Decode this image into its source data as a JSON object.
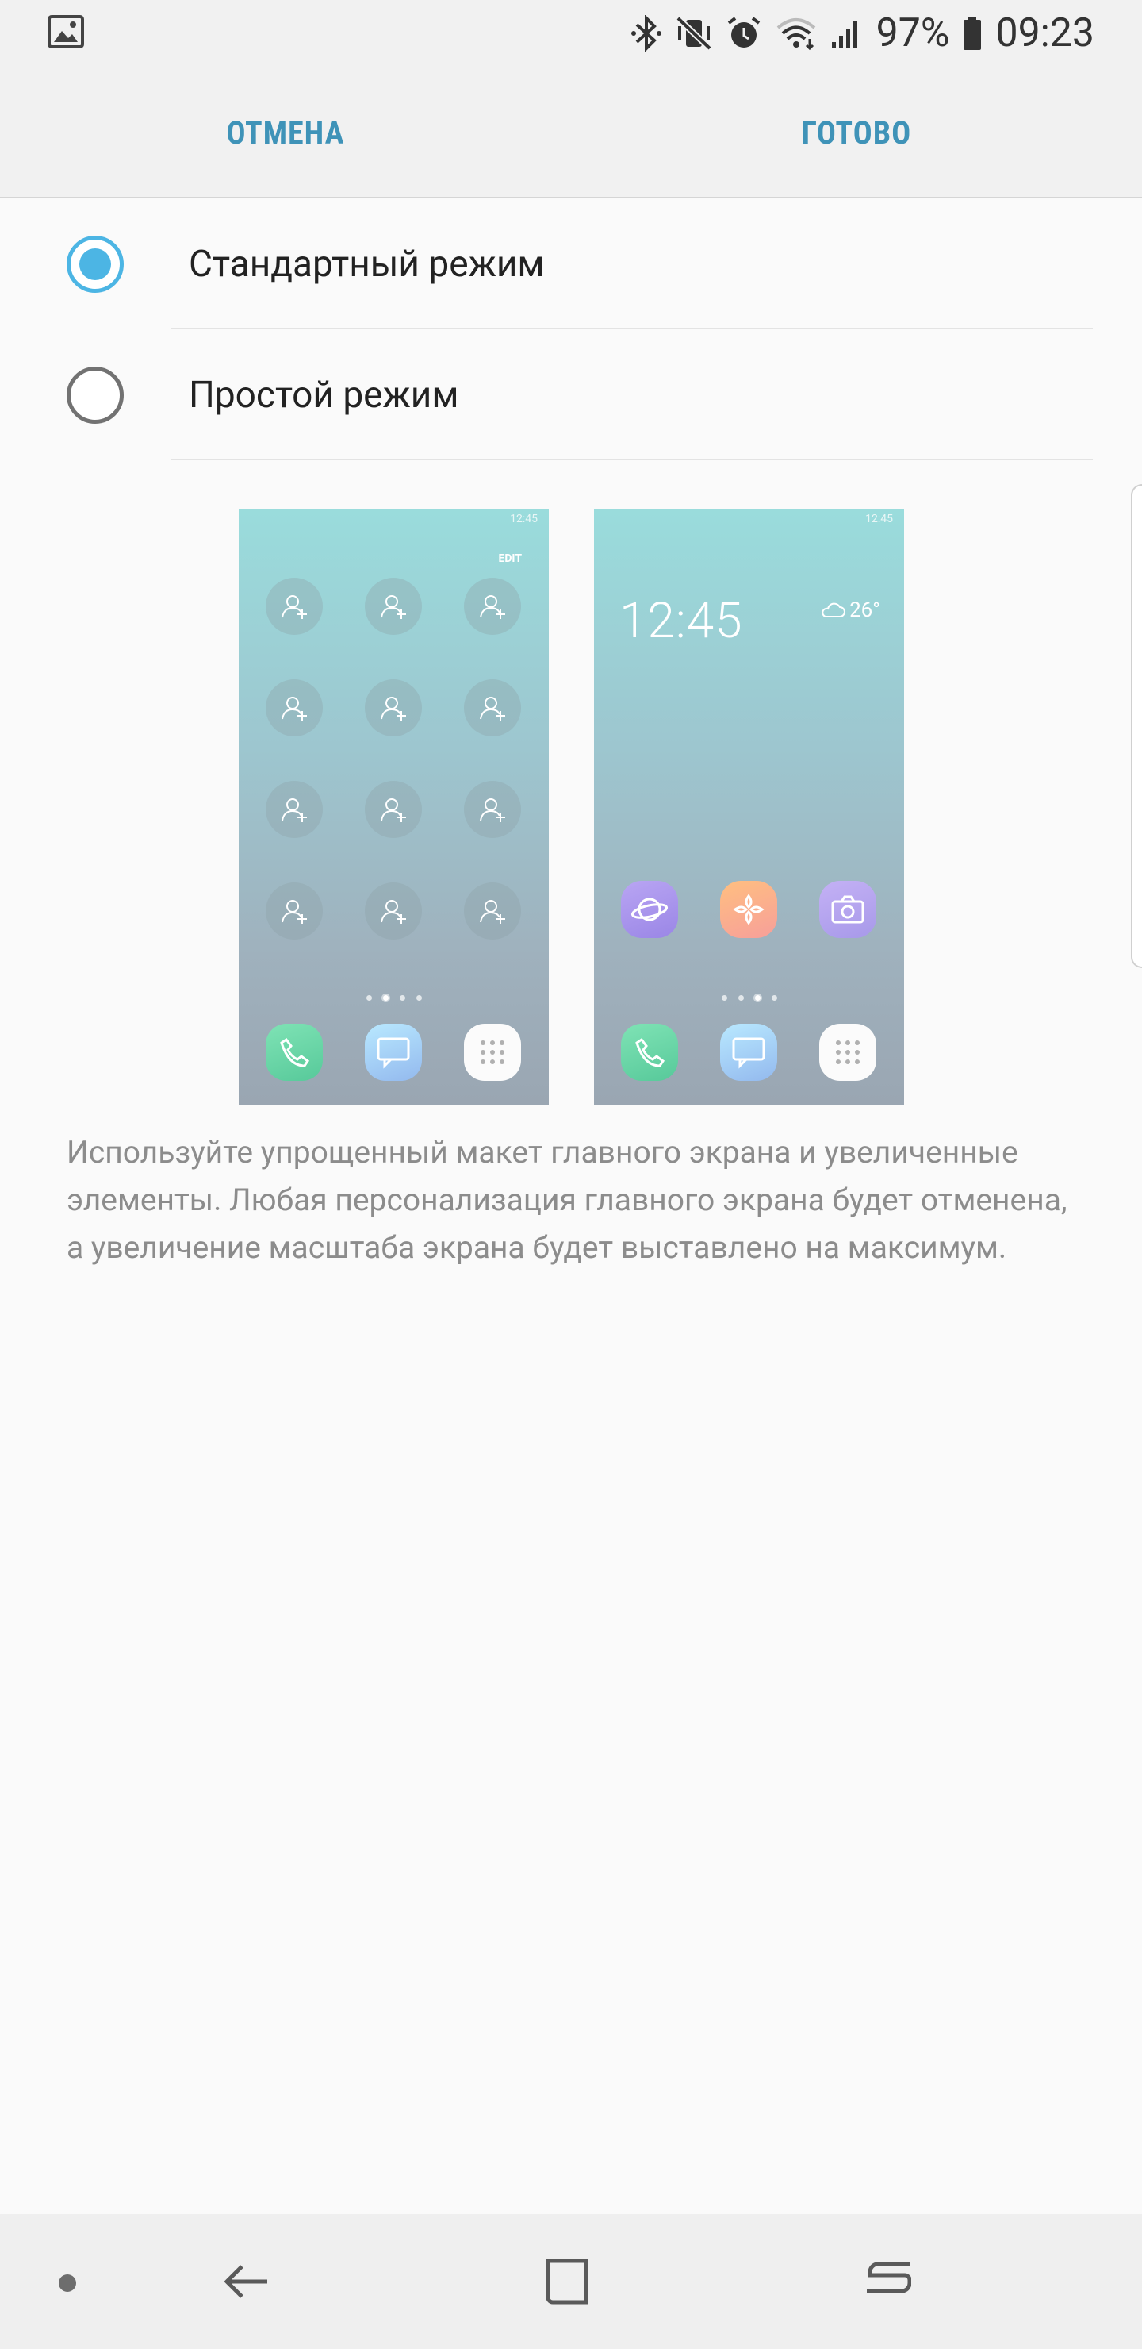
{
  "status_bar": {
    "battery_percent": "97%",
    "time": "09:23",
    "icons": [
      "image-notification-icon",
      "bluetooth-icon",
      "vibrate-mute-icon",
      "alarm-icon",
      "wifi-icon",
      "signal-icon",
      "battery-icon"
    ]
  },
  "action_bar": {
    "cancel_label": "ОТМЕНА",
    "done_label": "ГОТОВО"
  },
  "options": [
    {
      "label": "Стандартный режим",
      "selected": true
    },
    {
      "label": "Простой режим",
      "selected": false
    }
  ],
  "previews": {
    "standard": {
      "status_time": "12:45",
      "edit_label": "EDIT"
    },
    "easy": {
      "status_time": "12:45",
      "clock": "12:45",
      "temperature": "26°"
    }
  },
  "description": "Используйте упрощенный макет главного экрана и увеличенные элементы. Любая персонализация главного экрана будет отменена, а увеличение масштаба экрана будет выставлено на максимум.",
  "colors": {
    "accent": "#3f93b8",
    "radio_checked": "#4cb5e4",
    "background": "#fafafa",
    "bar_background": "#f1f1f1"
  },
  "nav_bar": {
    "icons": [
      "dot-indicator-icon",
      "back-icon",
      "home-icon",
      "recents-icon"
    ]
  }
}
